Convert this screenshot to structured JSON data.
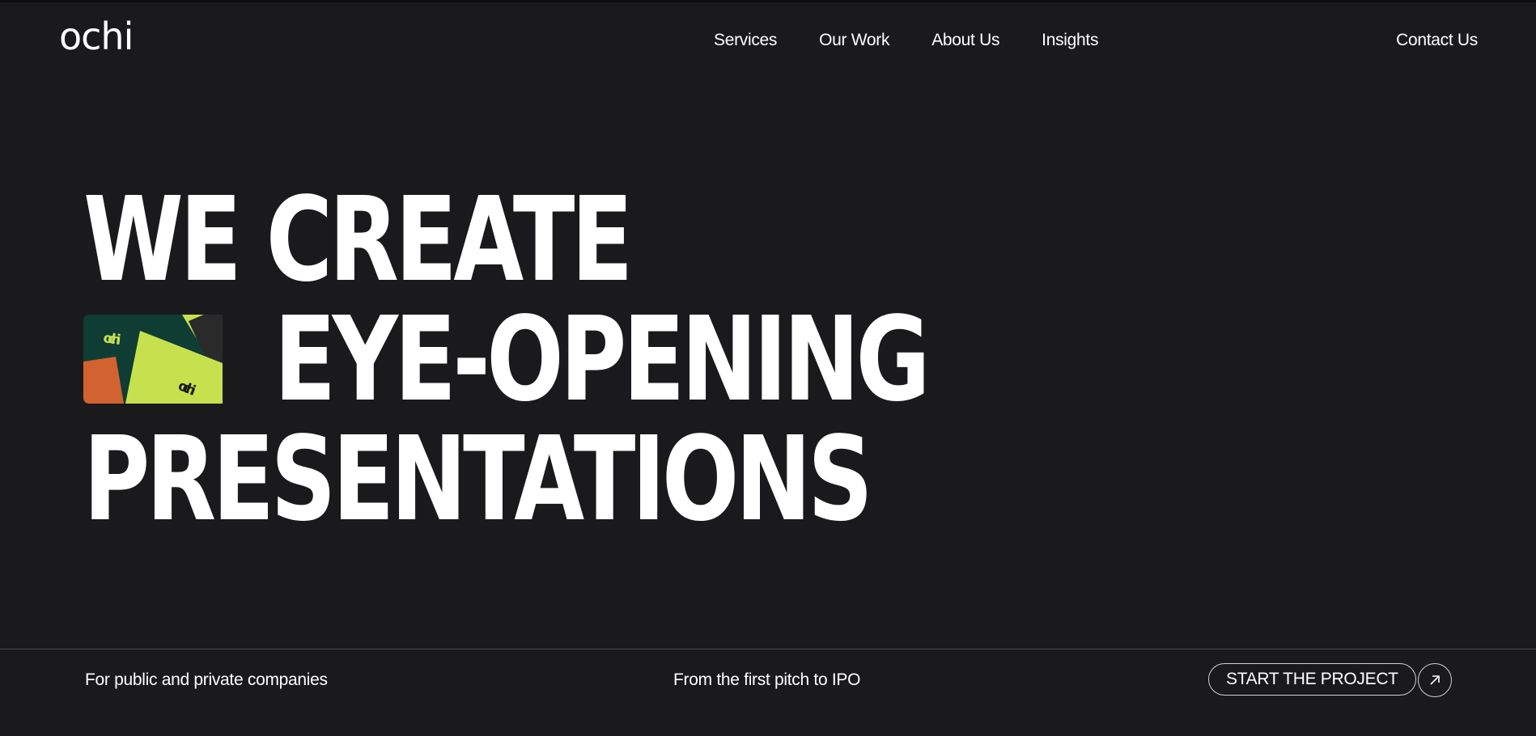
{
  "header": {
    "logo": "ochi",
    "nav": [
      {
        "label": "Services"
      },
      {
        "label": "Our Work"
      },
      {
        "label": "About Us"
      },
      {
        "label": "Insights"
      }
    ],
    "contact_label": "Contact Us"
  },
  "hero": {
    "line1": "WE CREATE",
    "line2": "EYE-OPENING",
    "line3": "PRESENTATIONS",
    "thumbnail": {
      "brand_text_1": "ochi",
      "brand_text_2": "ochi",
      "colors": {
        "background": "#0f3d34",
        "orange": "#d2622f",
        "lime": "#c6e14d",
        "dark": "#1c1c1c"
      }
    }
  },
  "footer": {
    "left_text": "For public and private companies",
    "middle_text": "From the first pitch to IPO",
    "cta_label": "START THE PROJECT",
    "cta_icon": "arrow-up-right-icon"
  },
  "colors": {
    "background": "#1a1a1c",
    "text": "#ffffff",
    "divider": "#4a4a4d"
  }
}
